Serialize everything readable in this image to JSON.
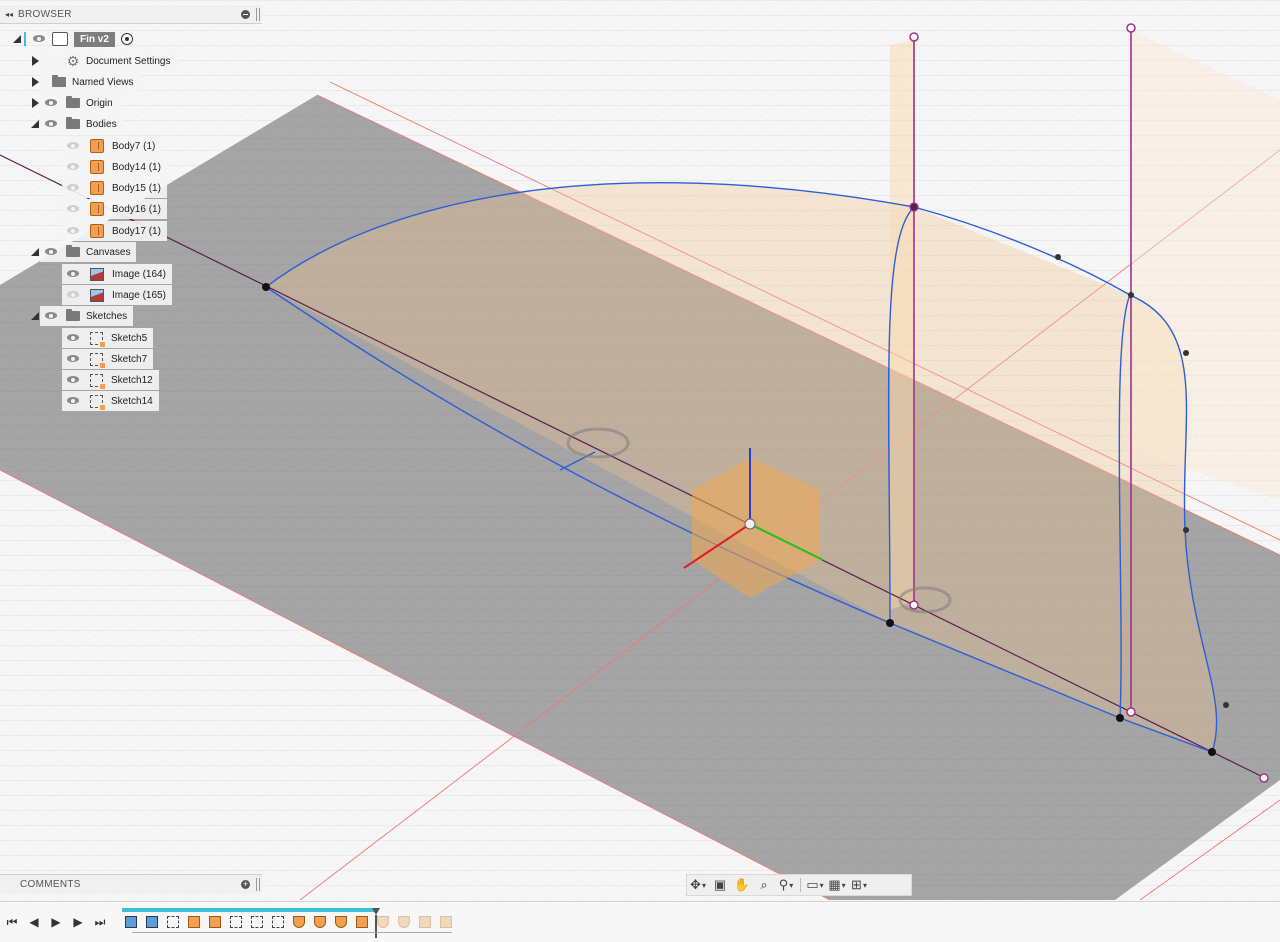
{
  "browser": {
    "title": "BROWSER",
    "component": "Fin v2",
    "items": [
      {
        "label": "Document Settings",
        "icon": "gear-icon"
      },
      {
        "label": "Named Views",
        "icon": "folder-icon"
      },
      {
        "label": "Origin",
        "icon": "folder-icon"
      },
      {
        "label": "Bodies",
        "icon": "folder-icon"
      },
      {
        "label": "Canvases",
        "icon": "folder-icon"
      },
      {
        "label": "Sketches",
        "icon": "folder-icon"
      }
    ],
    "bodies": [
      "Body7 (1)",
      "Body14 (1)",
      "Body15 (1)",
      "Body16 (1)",
      "Body17 (1)"
    ],
    "canvases": [
      "Image (164)",
      "Image (165)"
    ],
    "sketches": [
      "Sketch5",
      "Sketch7",
      "Sketch12",
      "Sketch14"
    ]
  },
  "comments": {
    "title": "COMMENTS"
  },
  "navbar": {
    "icons": [
      "orbit-icon",
      "look-at-icon",
      "pan-icon",
      "zoom-window-icon",
      "zoom-icon",
      "display-settings-icon",
      "grid-settings-icon",
      "viewports-icon"
    ]
  },
  "timeline": {
    "controls": [
      "go-to-start-icon",
      "step-back-icon",
      "play-icon",
      "step-forward-icon",
      "go-to-end-icon"
    ],
    "features": [
      "canvas",
      "canvas",
      "sketch",
      "extrude",
      "extrude",
      "sketch",
      "sketch",
      "sketch",
      "revolve",
      "revolve",
      "revolve",
      "revolve",
      "extrude",
      "revolve",
      "revolve",
      "extrude",
      "loft"
    ]
  },
  "colors": {
    "accent": "#3fc1d4",
    "sketch_curve": "#2a5fd8",
    "construction": "#a03090",
    "body": "#f0a050"
  }
}
